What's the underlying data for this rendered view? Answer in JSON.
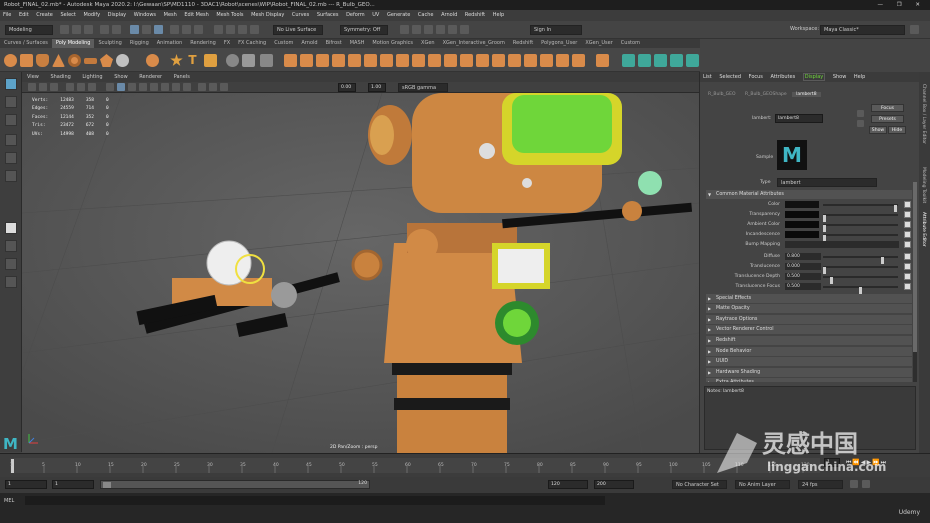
{
  "title_bar": {
    "text": "Robot_FINAL_02.mb* - Autodesk Maya 2020.2: I:\\Gewaan\\SP\\MD1110 - 3DAC1\\Robot\\scenes\\WIP\\Robot_FINAL_02.mb  ---  R_Bulb_GEO...",
    "controls": "— ❐ ✕"
  },
  "menu": [
    "File",
    "Edit",
    "Create",
    "Select",
    "Modify",
    "Display",
    "Windows",
    "Mesh",
    "Edit Mesh",
    "Mesh Tools",
    "Mesh Display",
    "Curves",
    "Surfaces",
    "Deform",
    "UV",
    "Generate",
    "Cache",
    "Arnold",
    "Redshift",
    "Help"
  ],
  "status_line": {
    "mode": "Modeling",
    "live_surface": "No Live Surface",
    "symmetry": "Symmetry: Off",
    "sign_in": "Sign In",
    "workspace_label": "Workspace:",
    "workspace": "Maya Classic*"
  },
  "shelf_tabs": [
    "Curves / Surfaces",
    "Poly Modeling",
    "Sculpting",
    "Rigging",
    "Animation",
    "Rendering",
    "FX",
    "FX Caching",
    "Custom",
    "Arnold",
    "Bifrost",
    "MASH",
    "Motion Graphics",
    "XGen",
    "XGen_Interactive_Groom",
    "Redshift",
    "Polygons_User",
    "XGen_User",
    "Custom"
  ],
  "shelf_active": "Poly Modeling",
  "viewport_menu": [
    "View",
    "Shading",
    "Lighting",
    "Show",
    "Renderer",
    "Panels"
  ],
  "viewport_toolbar": {
    "exposure": "0.00",
    "gamma": "1.00",
    "color_space": "sRGB gamma"
  },
  "hud": {
    "rows": [
      {
        "label": "Verts:",
        "a": "12483",
        "b": "358",
        "c": "0"
      },
      {
        "label": "Edges:",
        "a": "24559",
        "b": "714",
        "c": "0"
      },
      {
        "label": "Faces:",
        "a": "12144",
        "b": "352",
        "c": "0"
      },
      {
        "label": "Tris:",
        "a": "23472",
        "b": "672",
        "c": "0"
      },
      {
        "label": "UVs:",
        "a": "14998",
        "b": "408",
        "c": "0"
      }
    ]
  },
  "camera_label": "2D Pan/Zoom : persp",
  "attribute_editor": {
    "menu": [
      "List",
      "Selected",
      "Focus",
      "Attributes",
      "Display",
      "Show",
      "Help"
    ],
    "node_tabs": [
      "R_Bulb_GEO",
      "R_Bulb_GEOShape",
      "lambert8"
    ],
    "node_label": "lambert:",
    "node_name": "lambert8",
    "buttons": {
      "focus": "Focus",
      "presets": "Presets",
      "show": "Show",
      "hide": "Hide"
    },
    "sample_label": "Sample",
    "type_label": "Type",
    "type_value": "lambert",
    "common_section": "Common Material Attributes",
    "attributes": [
      {
        "label": "Color",
        "kind": "swatch",
        "color": "#111111",
        "level": 0.99
      },
      {
        "label": "Transparency",
        "kind": "swatch",
        "color": "#0a0a0a",
        "level": 0.0
      },
      {
        "label": "Ambient Color",
        "kind": "swatch",
        "color": "#0a0a0a",
        "level": 0.0
      },
      {
        "label": "Incandescence",
        "kind": "swatch",
        "color": "#0a0a0a",
        "level": 0.0
      },
      {
        "label": "Bump Mapping",
        "kind": "empty"
      },
      {
        "label": "Diffuse",
        "kind": "num",
        "value": "0.800",
        "level": 0.8
      },
      {
        "label": "Translucence",
        "kind": "num",
        "value": "0.000",
        "level": 0.0
      },
      {
        "label": "Translucence Depth",
        "kind": "num",
        "value": "0.500",
        "level": 0.1
      },
      {
        "label": "Translucence Focus",
        "kind": "num",
        "value": "0.500",
        "level": 0.5
      }
    ],
    "sections": [
      "Special Effects",
      "Matte Opacity",
      "Raytrace Options",
      "Vector Renderer Control",
      "Redshift",
      "Node Behavior",
      "UUID",
      "Hardware Shading",
      "Extra Attributes"
    ],
    "notes_label": "Notes:",
    "notes_value": "lambert8",
    "side_tabs": [
      "Channel Box / Layer Editor",
      "Modeling Toolkit",
      "Attribute Editor"
    ]
  },
  "timeline": {
    "ticks": [
      "1",
      "5",
      "10",
      "15",
      "20",
      "25",
      "30",
      "35",
      "40",
      "45",
      "50",
      "55",
      "60",
      "65",
      "70",
      "75",
      "80",
      "85",
      "90",
      "95",
      "100",
      "105",
      "110",
      "115",
      "120"
    ],
    "current_frame": "1"
  },
  "range": {
    "start": "1",
    "inner_start": "1",
    "inner_end": "120",
    "end": "120",
    "end2": "200",
    "character_set": "No Character Set",
    "anim_layer": "No Anim Layer",
    "fps": "24 fps"
  },
  "command_line": {
    "lang": "MEL"
  },
  "watermark": {
    "brand": "灵感中国",
    "url": "lingganchina.com"
  },
  "udemy": "Udemy",
  "colors": {
    "accent": "#5da3c9",
    "robot_orange": "#d98b4a",
    "screen_green": "#6fd63a",
    "viewport_bg": "#5c5c5c"
  }
}
